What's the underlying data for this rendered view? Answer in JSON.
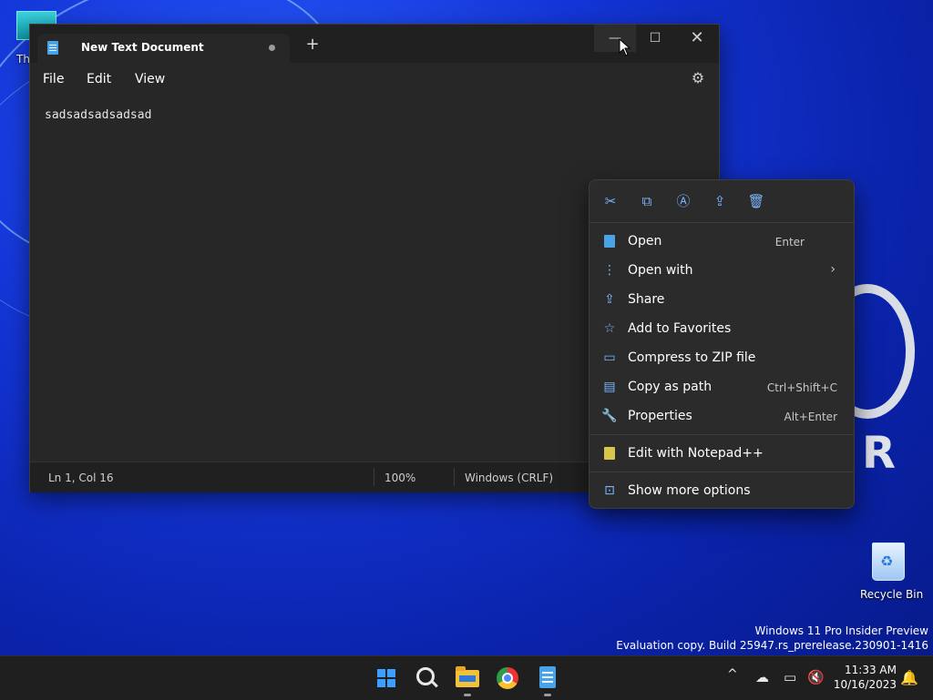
{
  "desktop": {
    "top_icon_label": "Th",
    "recycle_bin_label": "Recycle Bin",
    "watermark_line1": "Windows 11 Pro Insider Preview",
    "watermark_line2": "Evaluation copy. Build 25947.rs_prerelease.230901-1416",
    "logo_letter": "R"
  },
  "notepad": {
    "tab_title": "New Text Document",
    "new_tab_symbol": "+",
    "menu": [
      "File",
      "Edit",
      "View"
    ],
    "content": "sadsadsadsadsad",
    "status": {
      "position": "Ln 1, Col 16",
      "zoom": "100%",
      "line_ending": "Windows (CRLF)"
    },
    "window_controls": {
      "minimize": "—",
      "maximize": "☐",
      "close": "✕"
    }
  },
  "context_menu": {
    "toolbar": [
      {
        "name": "cut-icon",
        "glyph": "✂"
      },
      {
        "name": "copy-icon",
        "glyph": "⧉"
      },
      {
        "name": "rename-icon",
        "glyph": "Ⓐ"
      },
      {
        "name": "share-icon",
        "glyph": "⇪"
      },
      {
        "name": "delete-icon",
        "glyph": "🗑"
      }
    ],
    "items": [
      {
        "label": "Open",
        "shortcut": "Enter",
        "icon": "notepad-icon"
      },
      {
        "label": "Open with",
        "shortcut": "",
        "icon": "open-with-icon",
        "submenu": "›"
      },
      {
        "label": "Share",
        "shortcut": "",
        "icon": "share-icon"
      },
      {
        "label": "Add to Favorites",
        "shortcut": "",
        "icon": "star-icon"
      },
      {
        "label": "Compress to ZIP file",
        "shortcut": "",
        "icon": "zip-folder-icon"
      },
      {
        "label": "Copy as path",
        "shortcut": "Ctrl+Shift+C",
        "icon": "path-icon"
      },
      {
        "label": "Properties",
        "shortcut": "Alt+Enter",
        "icon": "wrench-icon"
      },
      {
        "label": "Edit with Notepad++",
        "shortcut": "",
        "icon": "notepad-plus-icon"
      },
      {
        "label": "Show more options",
        "shortcut": "",
        "icon": "more-options-icon"
      }
    ]
  },
  "taskbar": {
    "time": "11:33 AM",
    "date": "10/16/2023",
    "tray_chevron": "^"
  },
  "colors": {
    "accent": "#3aa0ff",
    "window_bg": "#272727",
    "menu_bg": "#2b2b2b"
  }
}
